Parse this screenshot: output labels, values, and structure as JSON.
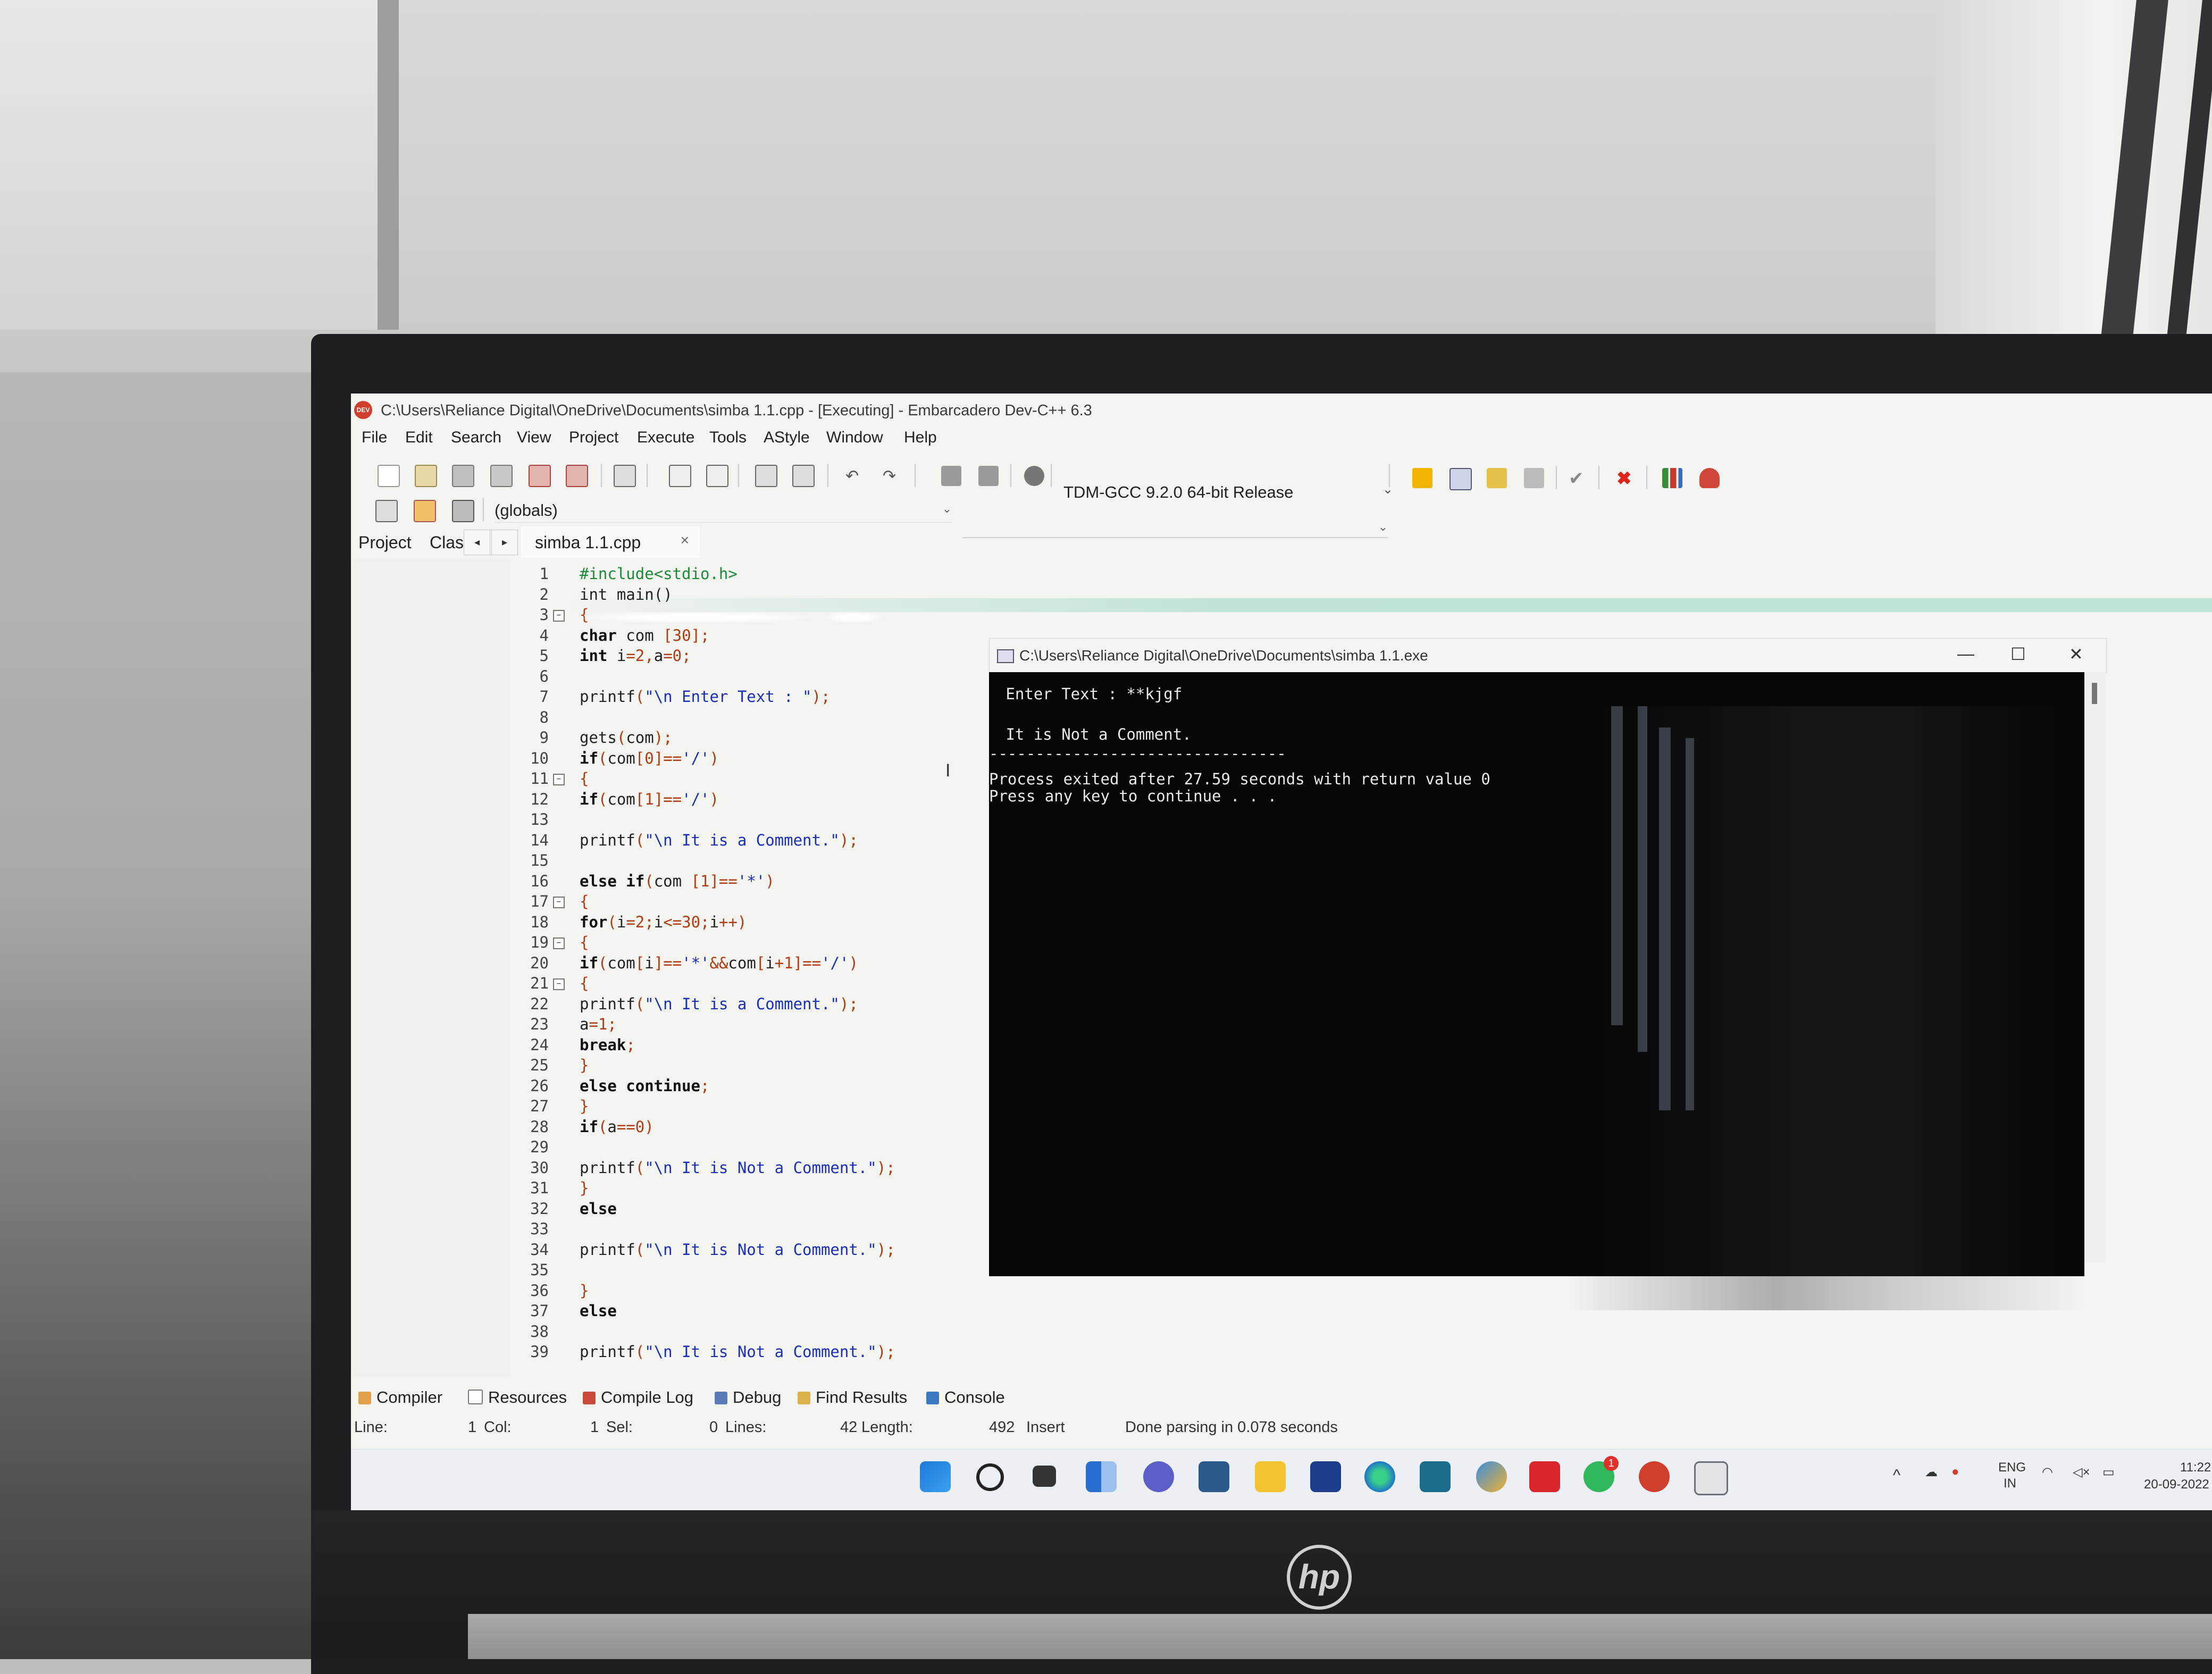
{
  "window": {
    "title": "C:\\Users\\Reliance Digital\\OneDrive\\Documents\\simba 1.1.cpp - [Executing] - Embarcadero Dev-C++ 6.3",
    "app_icon_text": "DEV"
  },
  "menu": [
    "File",
    "Edit",
    "Search",
    "View",
    "Project",
    "Execute",
    "Tools",
    "AStyle",
    "Window",
    "Help"
  ],
  "toolbar": {
    "compiler": "TDM-GCC 9.2.0 64-bit Release",
    "scope": "(globals)"
  },
  "side_tabs": {
    "project": "Project",
    "classes": "Clas"
  },
  "file_tab": {
    "label": "simba 1.1.cpp",
    "close": "×"
  },
  "editor": {
    "lines": [
      {
        "n": "1",
        "html": "<span class=\"pp\">#include&lt;stdio.h&gt;</span>"
      },
      {
        "n": "2",
        "html": "int main()"
      },
      {
        "n": "3",
        "html": "<span class=\"op\">{</span>",
        "fold": true
      },
      {
        "n": "4",
        "html": "<span class=\"k\">char</span> com <span class=\"op\">[</span><span class=\"n\">30</span><span class=\"op\">];</span>"
      },
      {
        "n": "5",
        "html": "<span class=\"k\">int</span> i<span class=\"op\">=</span><span class=\"n\">2</span><span class=\"op\">,</span>a<span class=\"op\">=</span><span class=\"n\">0</span><span class=\"op\">;</span>"
      },
      {
        "n": "6",
        "html": ""
      },
      {
        "n": "7",
        "html": "printf<span class=\"op\">(</span><span class=\"s\">\"\\n Enter Text : \"</span><span class=\"op\">);</span>"
      },
      {
        "n": "8",
        "html": ""
      },
      {
        "n": "9",
        "html": "gets<span class=\"op\">(</span>com<span class=\"op\">);</span>"
      },
      {
        "n": "10",
        "html": "<span class=\"k\">if</span><span class=\"op\">(</span>com<span class=\"op\">[</span><span class=\"n\">0</span><span class=\"op\">]==</span><span class=\"s\">'/'</span><span class=\"op\">)</span>"
      },
      {
        "n": "11",
        "html": "<span class=\"op\">{</span>",
        "fold": true
      },
      {
        "n": "12",
        "html": "<span class=\"k\">if</span><span class=\"op\">(</span>com<span class=\"op\">[</span><span class=\"n\">1</span><span class=\"op\">]==</span><span class=\"s\">'/'</span><span class=\"op\">)</span>"
      },
      {
        "n": "13",
        "html": ""
      },
      {
        "n": "14",
        "html": "printf<span class=\"op\">(</span><span class=\"s\">\"\\n It is a Comment.\"</span><span class=\"op\">);</span>"
      },
      {
        "n": "15",
        "html": ""
      },
      {
        "n": "16",
        "html": "<span class=\"k\">else if</span><span class=\"op\">(</span>com <span class=\"op\">[</span><span class=\"n\">1</span><span class=\"op\">]==</span><span class=\"s\">'*'</span><span class=\"op\">)</span>"
      },
      {
        "n": "17",
        "html": "<span class=\"op\">{</span>",
        "fold": true
      },
      {
        "n": "18",
        "html": "<span class=\"k\">for</span><span class=\"op\">(</span>i<span class=\"op\">=</span><span class=\"n\">2</span><span class=\"op\">;</span>i<span class=\"op\">&lt;=</span><span class=\"n\">30</span><span class=\"op\">;</span>i<span class=\"op\">++)</span>"
      },
      {
        "n": "19",
        "html": "<span class=\"op\">{</span>",
        "fold": true
      },
      {
        "n": "20",
        "html": "<span class=\"k\">if</span><span class=\"op\">(</span>com<span class=\"op\">[</span>i<span class=\"op\">]==</span><span class=\"s\">'*'</span><span class=\"op\">&amp;&amp;</span>com<span class=\"op\">[</span>i<span class=\"op\">+</span><span class=\"n\">1</span><span class=\"op\">]==</span><span class=\"s\">'/'</span><span class=\"op\">)</span>"
      },
      {
        "n": "21",
        "html": "<span class=\"op\">{</span>",
        "fold": true
      },
      {
        "n": "22",
        "html": "printf<span class=\"op\">(</span><span class=\"s\">\"\\n It is a Comment.\"</span><span class=\"op\">);</span>"
      },
      {
        "n": "23",
        "html": "a<span class=\"op\">=</span><span class=\"n\">1</span><span class=\"op\">;</span>"
      },
      {
        "n": "24",
        "html": "<span class=\"k\">break</span><span class=\"op\">;</span>"
      },
      {
        "n": "25",
        "html": "<span class=\"op\">}</span>"
      },
      {
        "n": "26",
        "html": "<span class=\"k\">else continue</span><span class=\"op\">;</span>"
      },
      {
        "n": "27",
        "html": "<span class=\"op\">}</span>"
      },
      {
        "n": "28",
        "html": "<span class=\"k\">if</span><span class=\"op\">(</span>a<span class=\"op\">==</span><span class=\"n\">0</span><span class=\"op\">)</span>"
      },
      {
        "n": "29",
        "html": ""
      },
      {
        "n": "30",
        "html": "printf<span class=\"op\">(</span><span class=\"s\">\"\\n It is Not a Comment.\"</span><span class=\"op\">);</span>"
      },
      {
        "n": "31",
        "html": "<span class=\"op\">}</span>"
      },
      {
        "n": "32",
        "html": "<span class=\"k\">else</span>"
      },
      {
        "n": "33",
        "html": ""
      },
      {
        "n": "34",
        "html": "printf<span class=\"op\">(</span><span class=\"s\">\"\\n It is Not a Comment.\"</span><span class=\"op\">);</span>"
      },
      {
        "n": "35",
        "html": ""
      },
      {
        "n": "36",
        "html": "<span class=\"op\">}</span>"
      },
      {
        "n": "37",
        "html": "<span class=\"k\">else</span>"
      },
      {
        "n": "38",
        "html": ""
      },
      {
        "n": "39",
        "html": "printf<span class=\"op\">(</span><span class=\"s\">\"\\n It is Not a Comment.\"</span><span class=\"op\">);</span>"
      }
    ]
  },
  "console": {
    "title": "C:\\Users\\Reliance Digital\\OneDrive\\Documents\\simba 1.1.exe",
    "lines": [
      " Enter Text : **kjgf",
      "",
      " It is Not a Comment.",
      "--------------------------------",
      "Process exited after 27.59 seconds with return value 0",
      "Press any key to continue . . ."
    ],
    "controls": {
      "minimize": "—",
      "maximize": "☐",
      "close": "✕"
    }
  },
  "bottom_tabs": [
    "Compiler",
    "Resources",
    "Compile Log",
    "Debug",
    "Find Results",
    "Console"
  ],
  "status": {
    "line_label": "Line:",
    "line_value": "1",
    "col_label": "Col:",
    "col_value": "1",
    "sel_label": "Sel:",
    "sel_value": "0",
    "lines_label": "Lines:",
    "lines_value": "42",
    "length_label": "Length:",
    "length_value": "492",
    "mode": "Insert",
    "message": "Done parsing in 0.078 seconds"
  },
  "tray": {
    "lang1": "ENG",
    "lang2": "IN",
    "time": "11:22",
    "date": "20-09-2022",
    "badge": "1"
  },
  "laptop_logo": "hp",
  "colors": {
    "string": "#1a2fb8",
    "number": "#b23b14",
    "preprocessor": "#1c8a3a",
    "console_bg": "#050505"
  }
}
